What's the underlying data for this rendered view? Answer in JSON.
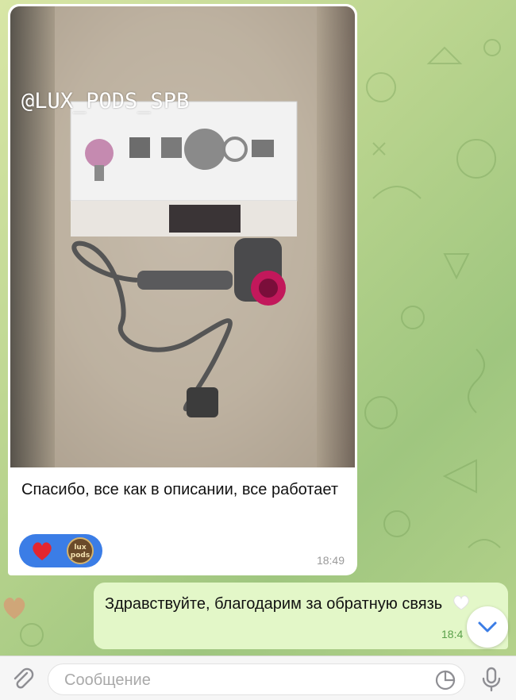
{
  "incoming_message": {
    "watermark": "@LUX_PODS_SPB",
    "text": "Спасибо, все как в описании, все работает",
    "time": "18:49",
    "reactions": [
      {
        "icon": "red-heart-icon"
      },
      {
        "icon": "lux-pods-avatar",
        "label": "lux pods"
      }
    ]
  },
  "outgoing_message": {
    "text": "Здравствуйте, благодарим за обратную связь",
    "emoji": "white-heart-icon",
    "time": "18:4"
  },
  "composer": {
    "placeholder": "Сообщение"
  },
  "colors": {
    "accent": "#3b7de6",
    "outgoing_bubble": "#e3f7c8",
    "incoming_bubble": "#ffffff",
    "heart": "#e3262f"
  }
}
